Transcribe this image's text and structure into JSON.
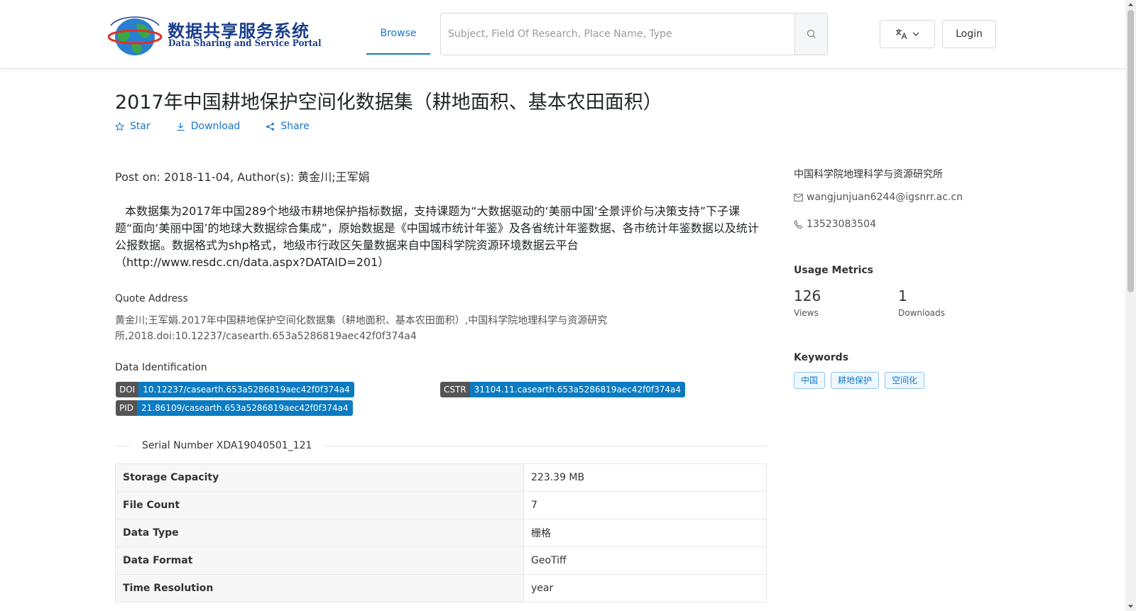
{
  "header": {
    "logo_cn": "数据共享服务系统",
    "logo_en": "Data Sharing and Service Portal",
    "nav_browse": "Browse",
    "search_placeholder": "Subject, Field Of Research, Place Name, Type",
    "login_label": "Login",
    "active_color": "#1677c9"
  },
  "dataset": {
    "title": "2017年中国耕地保护空间化数据集（耕地面积、基本农田面积）",
    "actions": {
      "star": "Star",
      "download": "Download",
      "share": "Share"
    },
    "post_on": "Post on: 2018-11-04, Author(s): 黄金川;王军娟",
    "description": "本数据集为2017年中国289个地级市耕地保护指标数据，支持课题为“大数据驱动的‘美丽中国’全景评价与决策支持”下子课题“面向‘美丽中国’的地球大数据综合集成”，原始数据是《中国城市统计年鉴》及各省统计年鉴数据、各市统计年鉴数据以及统计公报数据。数据格式为shp格式，地级市行政区矢量数据来自中国科学院资源环境数据云平台（http://www.resdc.cn/data.aspx?DATAID=201）",
    "quote_label": "Quote Address",
    "quote_text": "黄金川;王军娟.2017年中国耕地保护空间化数据集（耕地面积、基本农田面积）,中国科学院地理科学与资源研究所,2018.doi:10.12237/casearth.653a5286819aec42f0f374a4",
    "identification_label": "Data Identification",
    "doi": {
      "key": "DOI",
      "value": "10.12237/casearth.653a5286819aec42f0f374a4"
    },
    "cstr": {
      "key": "CSTR",
      "value": "31104.11.casearth.653a5286819aec42f0f374a4"
    },
    "pid": {
      "key": "PID",
      "value": "21.86109/casearth.653a5286819aec42f0f374a4"
    },
    "serial_number": "Serial Number XDA19040501_121",
    "properties": [
      {
        "key": "Storage Capacity",
        "value": "223.39 MB"
      },
      {
        "key": "File Count",
        "value": "7"
      },
      {
        "key": "Data Type",
        "value": "栅格"
      },
      {
        "key": "Data Format",
        "value": "GeoTiff"
      },
      {
        "key": "Time Resolution",
        "value": "year"
      }
    ]
  },
  "sidebar": {
    "organization": "中国科学院地理科学与资源研究所",
    "email": "wangjunjuan6244@igsnrr.ac.cn",
    "phone": "13523083504",
    "usage_heading": "Usage Metrics",
    "views_count": "126",
    "views_label": "Views",
    "downloads_count": "1",
    "downloads_label": "Downloads",
    "keywords_heading": "Keywords",
    "keywords": [
      "中国",
      "耕地保护",
      "空间化"
    ]
  }
}
